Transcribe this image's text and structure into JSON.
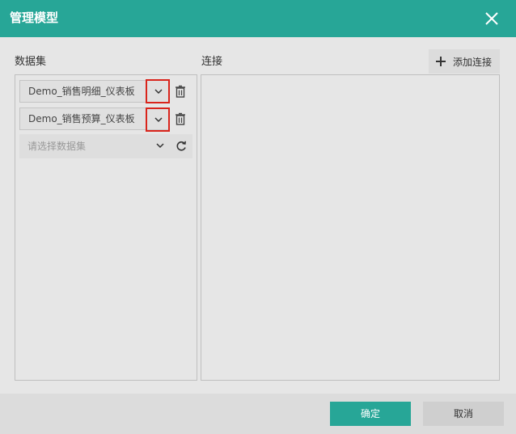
{
  "dialog": {
    "title": "管理模型",
    "close_icon": "close-icon"
  },
  "datasets": {
    "label": "数据集",
    "items": [
      {
        "name": "Demo_销售明细_仪表板"
      },
      {
        "name": "Demo_销售预算_仪表板"
      }
    ],
    "select_placeholder": "请选择数据集"
  },
  "connections": {
    "label": "连接",
    "add_label": "添加连接"
  },
  "footer": {
    "ok_label": "确定",
    "cancel_label": "取消"
  },
  "colors": {
    "accent": "#27a697",
    "highlight": "#d9241b"
  }
}
